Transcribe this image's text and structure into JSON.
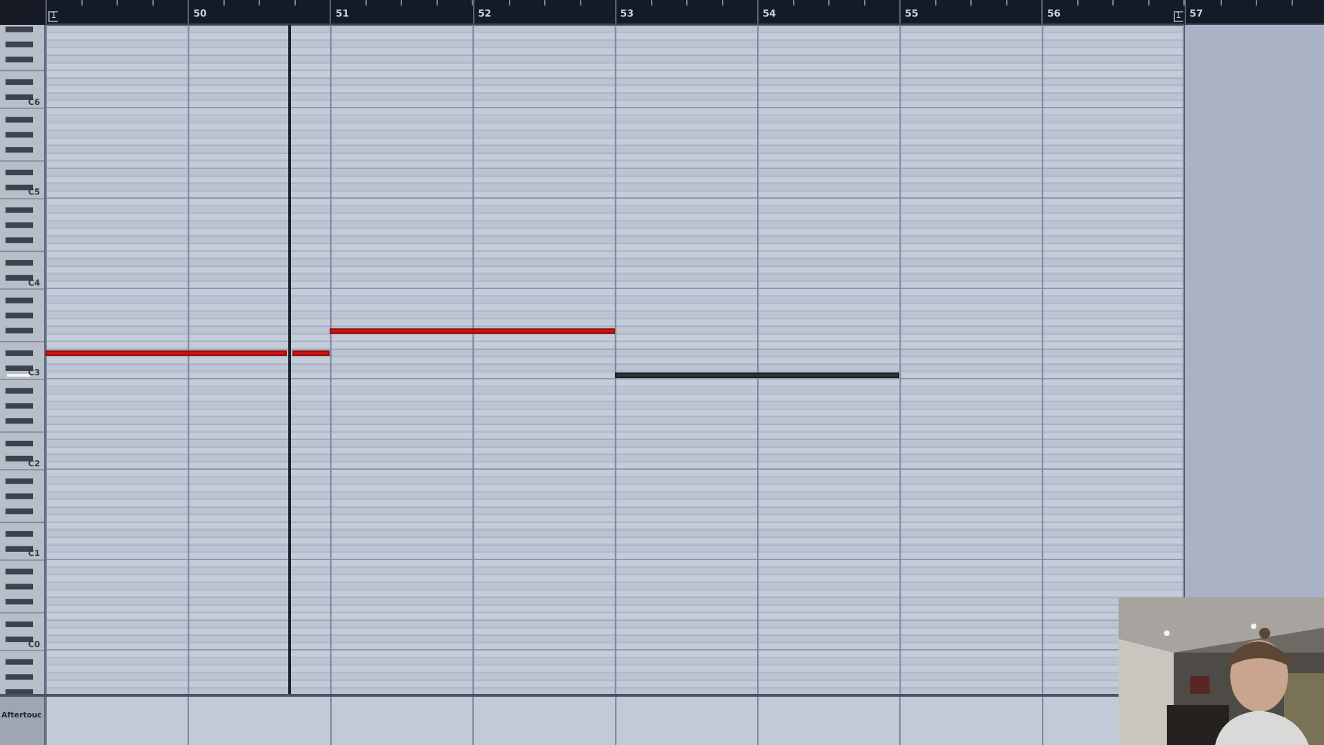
{
  "ruler": {
    "bars": [
      {
        "label": "50"
      },
      {
        "label": "51"
      },
      {
        "label": "52"
      },
      {
        "label": "53"
      },
      {
        "label": "54"
      },
      {
        "label": "55"
      },
      {
        "label": "56"
      },
      {
        "label": "57"
      }
    ],
    "left_locator": "1",
    "right_locator": "1"
  },
  "keyboard": {
    "octave_labels": [
      {
        "label": "C6",
        "pressed": false
      },
      {
        "label": "C5",
        "pressed": false
      },
      {
        "label": "C4",
        "pressed": false
      },
      {
        "label": "C3",
        "pressed": true
      },
      {
        "label": "C2",
        "pressed": false
      },
      {
        "label": "C1",
        "pressed": false
      },
      {
        "label": "C0",
        "pressed": false
      }
    ]
  },
  "notes": [
    {
      "selected": false
    },
    {
      "selected": false
    },
    {
      "selected": false
    },
    {
      "selected": true
    }
  ],
  "controller_lane": {
    "label": "Aftertouc"
  }
}
